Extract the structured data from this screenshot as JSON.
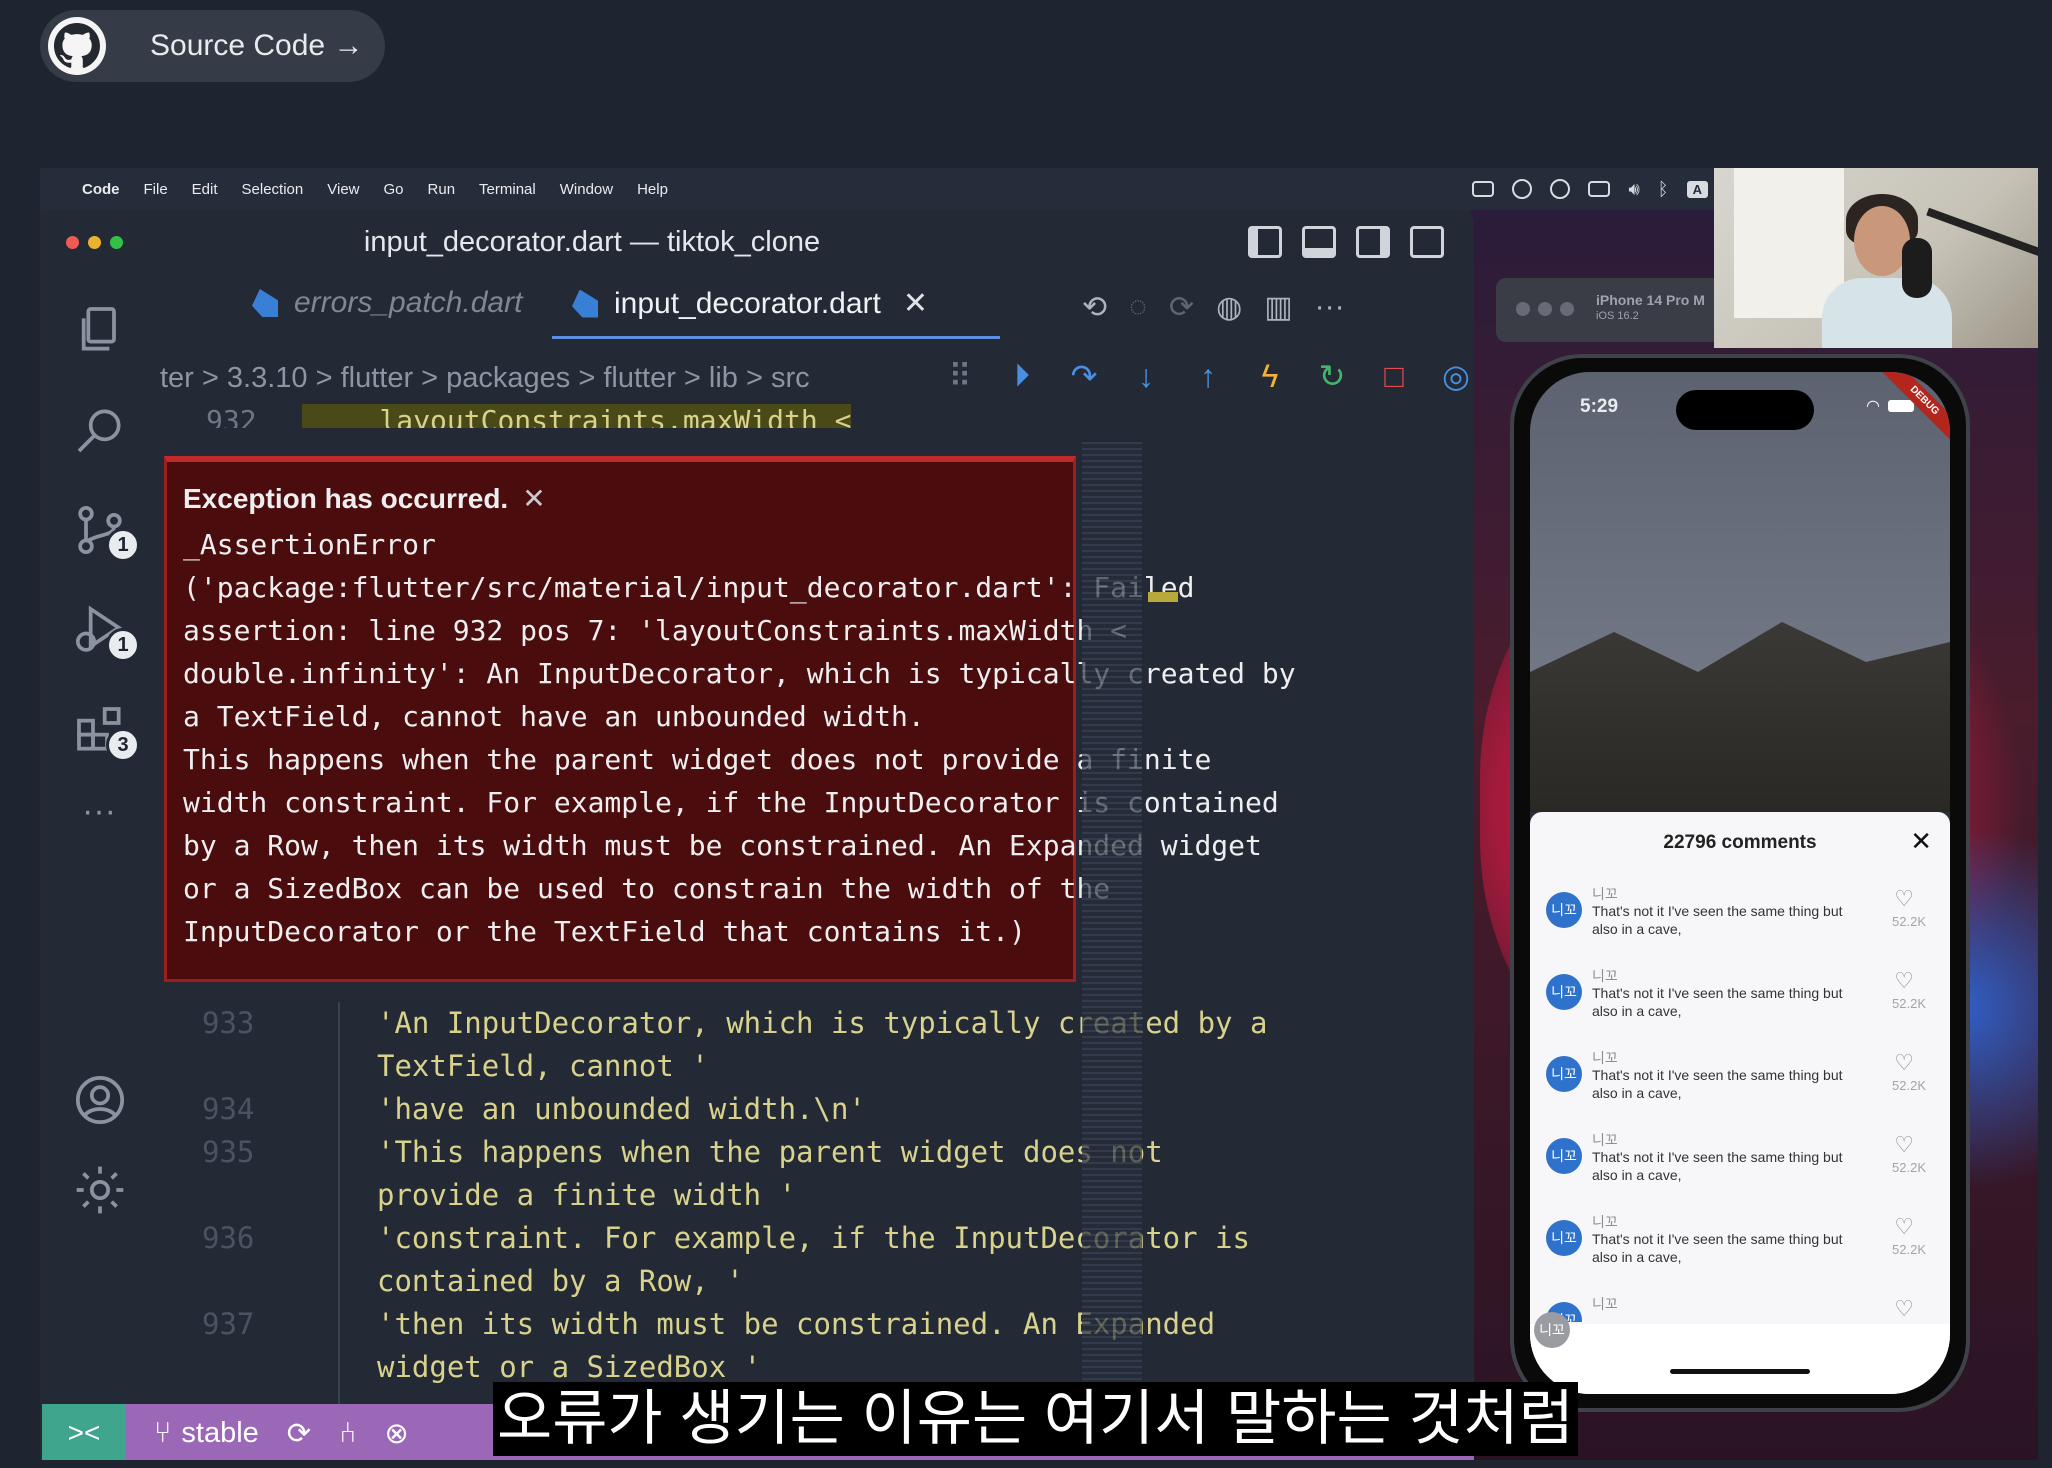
{
  "source_button": {
    "label": "Source Code →"
  },
  "menubar": {
    "app": "Code",
    "items": [
      "File",
      "Edit",
      "Selection",
      "View",
      "Go",
      "Run",
      "Terminal",
      "Window",
      "Help"
    ]
  },
  "window_title": "input_decorator.dart — tiktok_clone",
  "tabs": [
    {
      "label": "errors_patch.dart",
      "active": false
    },
    {
      "label": "input_decorator.dart",
      "active": true
    }
  ],
  "breadcrumb": "ter > 3.3.10 > flutter > packages > flutter > lib > src",
  "activity_badges": {
    "scm": "1",
    "debug": "1",
    "extensions": "3"
  },
  "previous_line": {
    "number": "932",
    "code": "layoutConstraints.maxWidth <"
  },
  "exception": {
    "title": "Exception has occurred.",
    "message": "_AssertionError\n('package:flutter/src/material/input_decorator.dart': Failed\nassertion: line 932 pos 7: 'layoutConstraints.maxWidth <\ndouble.infinity': An InputDecorator, which is typically created by\na TextField, cannot have an unbounded width.\nThis happens when the parent widget does not provide a finite\nwidth constraint. For example, if the InputDecorator is contained\nby a Row, then its width must be constrained. An Expanded widget\nor a SizedBox can be used to constrain the width of the\nInputDecorator or the TextField that contains it.)"
  },
  "code_lines": {
    "gutter": [
      "933",
      "",
      "934",
      "935",
      "",
      "936",
      "",
      "937"
    ],
    "text": "'An InputDecorator, which is typically created by a\nTextField, cannot '\n'have an unbounded width.\\n'\n'This happens when the parent widget does not\nprovide a finite width '\n'constraint. For example, if the InputDecorator is\ncontained by a Row, '\n'then its width must be constrained. An Expanded\nwidget or a SizedBox '"
  },
  "statusbar": {
    "branch": "stable"
  },
  "subtitle": "오류가 생기는 이유는 여기서 말하는 것처럼",
  "simulator": {
    "device": "iPhone 14 Pro M",
    "os": "iOS 16.2"
  },
  "phone": {
    "time": "5:29",
    "debug_label": "DEBUG",
    "sheet_title": "22796 comments",
    "comments": [
      {
        "avatar": "니꼬",
        "user": "니꼬",
        "text": "That's not it I've seen the same thing but also in a cave,",
        "likes": "52.2K"
      },
      {
        "avatar": "니꼬",
        "user": "니꼬",
        "text": "That's not it I've seen the same thing but also in a cave,",
        "likes": "52.2K"
      },
      {
        "avatar": "니꼬",
        "user": "니꼬",
        "text": "That's not it I've seen the same thing but also in a cave,",
        "likes": "52.2K"
      },
      {
        "avatar": "니꼬",
        "user": "니꼬",
        "text": "That's not it I've seen the same thing but also in a cave,",
        "likes": "52.2K"
      },
      {
        "avatar": "니꼬",
        "user": "니꼬",
        "text": "That's not it I've seen the same thing but also in a cave,",
        "likes": "52.2K"
      },
      {
        "avatar": "니꼬",
        "user": "니꼬",
        "text": "",
        "likes": ""
      }
    ],
    "floating_avatar": "니꼬"
  }
}
